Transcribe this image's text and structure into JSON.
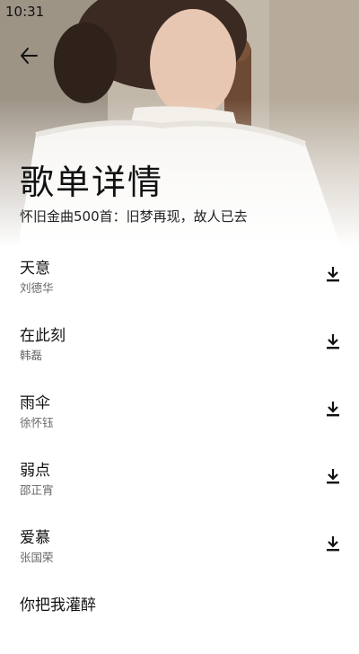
{
  "status_bar": {
    "time": "10:31"
  },
  "header": {
    "back_icon": "arrow-left-icon",
    "title": "歌单详情",
    "subtitle": "怀旧金曲500首：旧梦再现，故人已去"
  },
  "songs": [
    {
      "title": "天意",
      "artist": "刘德华"
    },
    {
      "title": "在此刻",
      "artist": "韩磊"
    },
    {
      "title": "雨伞",
      "artist": "徐怀钰"
    },
    {
      "title": "弱点",
      "artist": "邵正宵"
    },
    {
      "title": "爱慕",
      "artist": "张国荣"
    },
    {
      "title": "你把我灌醉",
      "artist": ""
    }
  ],
  "icons": {
    "download": "download-icon"
  },
  "colors": {
    "text_primary": "#111111",
    "text_secondary": "#666666"
  }
}
